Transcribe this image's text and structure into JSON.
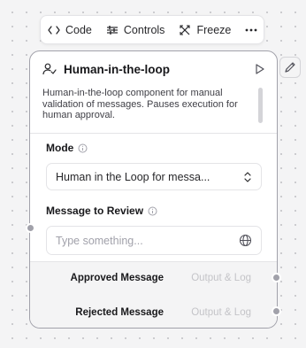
{
  "toolbar": {
    "code_label": "Code",
    "code_icon": "code-icon",
    "controls_label": "Controls",
    "controls_icon": "sliders-icon",
    "freeze_label": "Freeze",
    "freeze_icon": "snowflake-icon",
    "more_icon": "more-horizontal-icon"
  },
  "node": {
    "icon": "user-check-icon",
    "title": "Human-in-the-loop",
    "run_icon": "play-icon",
    "description": "Human-in-the-loop component for manual validation of messages. Pauses execution for human approval.",
    "fields": {
      "mode": {
        "label": "Mode",
        "value": "Human in the Loop for messa...",
        "icon": "chevrons-up-down-icon"
      },
      "message": {
        "label": "Message to Review",
        "placeholder": "Type something...",
        "icon": "globe-icon"
      }
    },
    "outputs": [
      {
        "name": "Approved Message",
        "log": "Output & Log"
      },
      {
        "name": "Rejected Message",
        "log": "Output & Log"
      }
    ]
  },
  "colors": {
    "canvas_bg": "#f4f4f5",
    "node_border": "#a1a1aa",
    "handle": "#a1a1aa",
    "muted_text": "#c4c4c8"
  }
}
